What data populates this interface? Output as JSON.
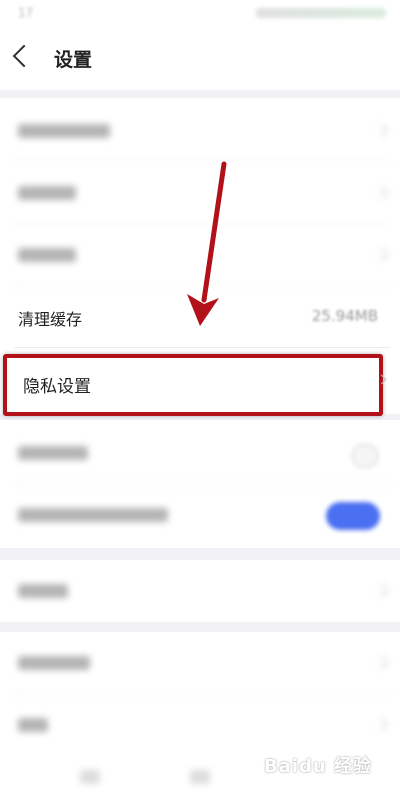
{
  "status_bar": {
    "time": "17"
  },
  "header": {
    "title": "设置"
  },
  "settings": {
    "rows": [
      {
        "label": "清理缓存",
        "value": "25.94MB"
      },
      {
        "label": "隐私设置"
      }
    ]
  },
  "watermark": {
    "text": "Baidu 经验"
  },
  "colors": {
    "highlight": "#b3111a",
    "accent": "#4a6ff0"
  }
}
